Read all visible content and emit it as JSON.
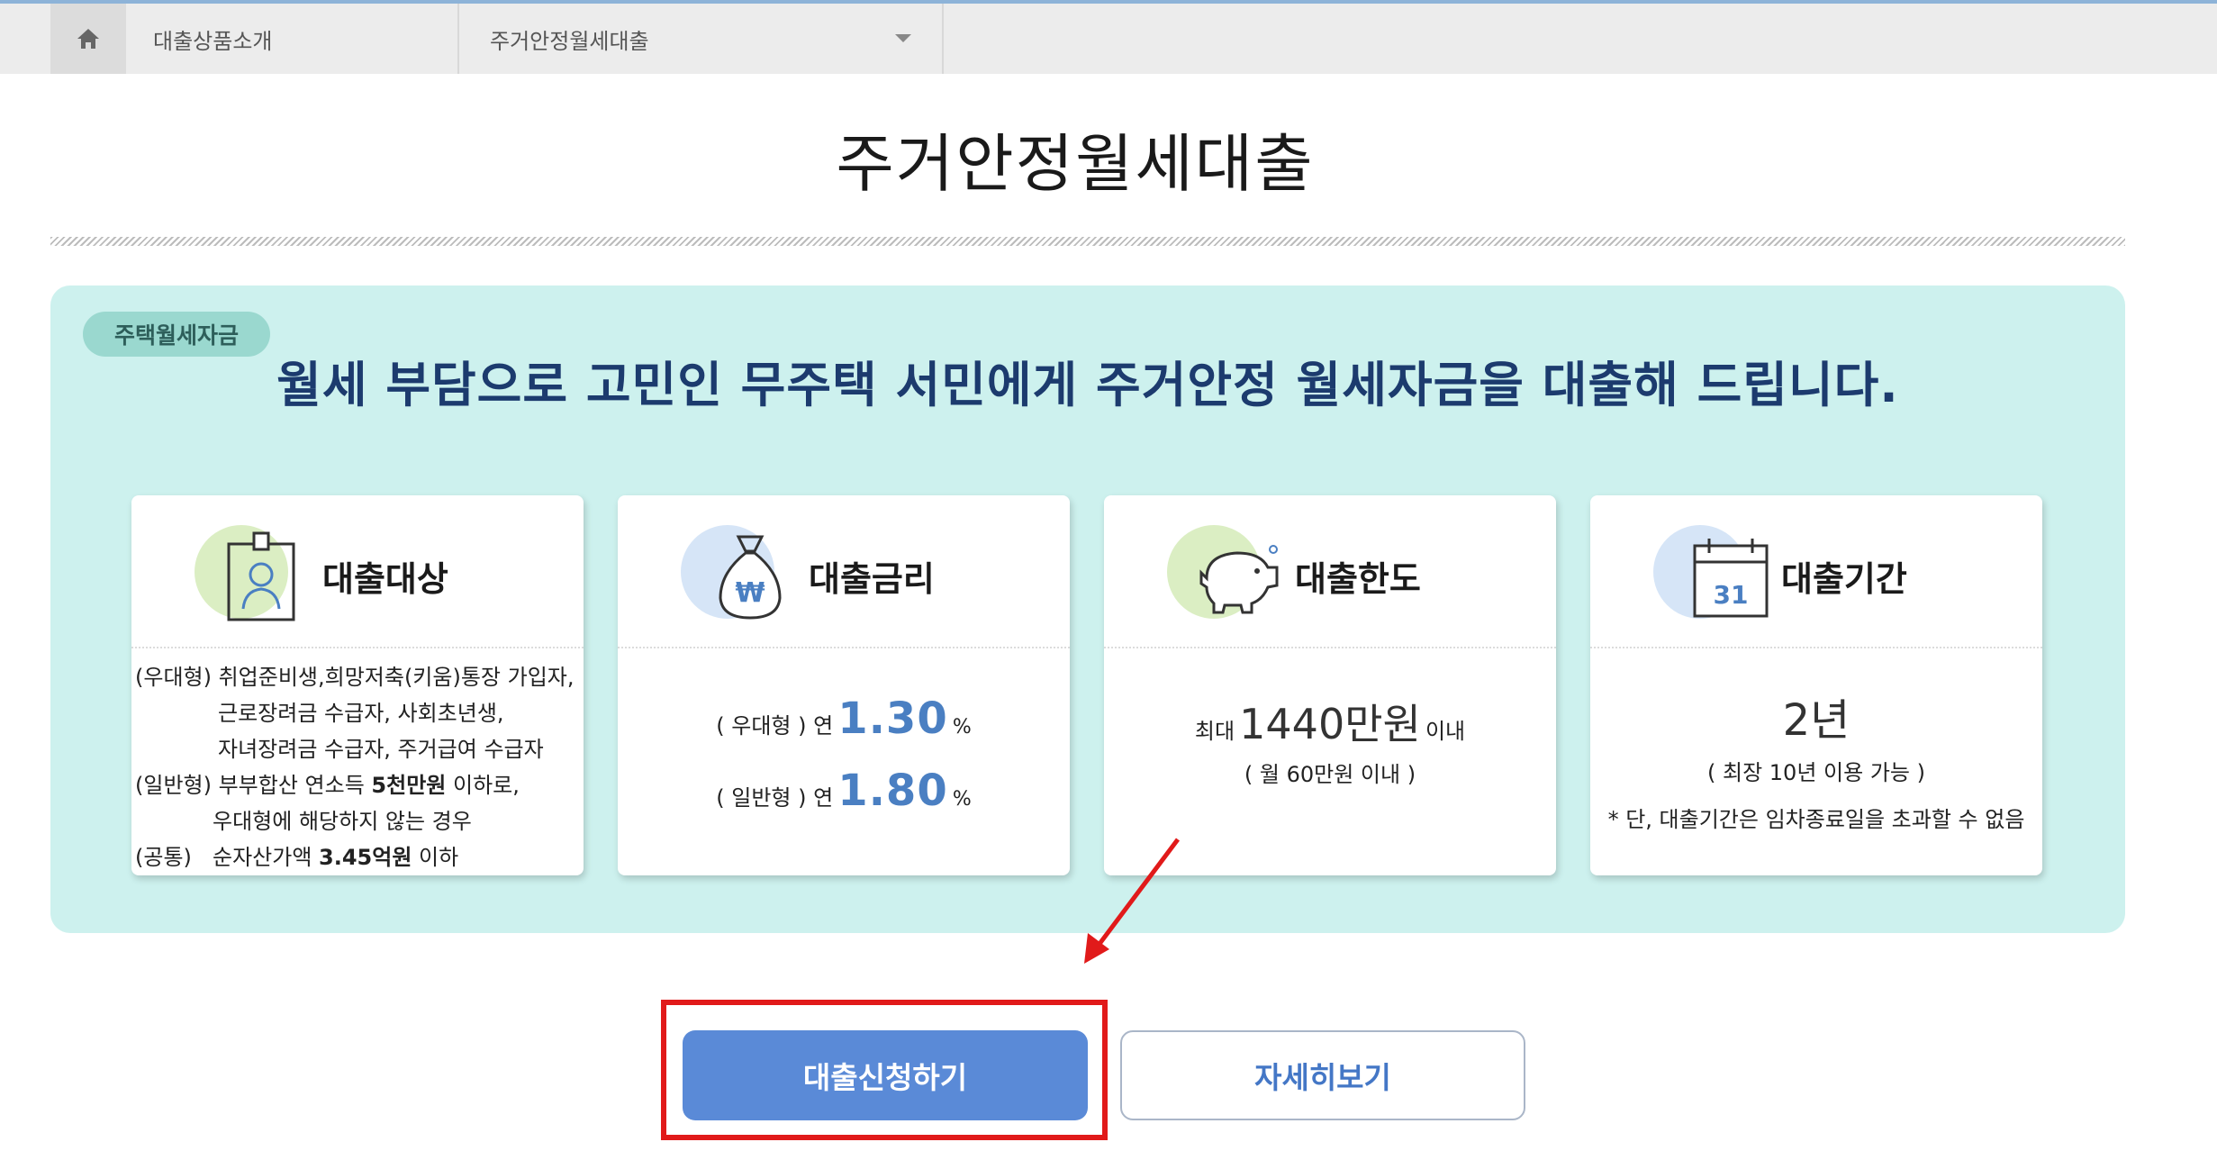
{
  "breadcrumb": {
    "home_icon": "home-icon",
    "item1": "대출상품소개",
    "item2": "주거안정월세대출"
  },
  "page_title": "주거안정월세대출",
  "panel": {
    "tag": "주택월세자금",
    "headline": "월세 부담으로 고민인 무주택 서민에게 주거안정 월세자금을 대출해 드립니다."
  },
  "cards": {
    "target": {
      "title": "대출대상",
      "icon": "id-badge-icon",
      "lines": [
        "(우대형) 취업준비생,희망저축(키움)통장 가입자,",
        "근로장려금 수급자, 사회초년생,",
        "자녀장려금 수급자, 주거급여 수급자",
        "(일반형) 부부합산 연소득 ",
        "5천만원",
        " 이하로,",
        "우대형에 해당하지 않는 경우",
        "(공통)",
        "순자산가액 ",
        "3.45억원",
        " 이하"
      ]
    },
    "rate": {
      "title": "대출금리",
      "icon": "money-bag-icon",
      "preferred": {
        "prefix": "( 우대형 ) 연",
        "value": "1.30",
        "unit": "%"
      },
      "general": {
        "prefix": "( 일반형 ) 연",
        "value": "1.80",
        "unit": "%"
      }
    },
    "limit": {
      "title": "대출한도",
      "icon": "piggy-bank-icon",
      "prefix": "최대",
      "amount": "1440만원",
      "suffix": "이내",
      "note": "( 월 60만원 이내 )"
    },
    "period": {
      "title": "대출기간",
      "icon": "calendar-icon",
      "calendar_day": "31",
      "value": "2년",
      "note": "( 최장 10년 이용 가능 )",
      "footnote": "* 단, 대출기간은 임차종료일을 초과할 수 없음"
    }
  },
  "buttons": {
    "apply": "대출신청하기",
    "more": "자세히보기"
  },
  "colors": {
    "panel_bg": "#cdf1ee",
    "accent_blue": "#5a8ad7",
    "headline": "#1c3b6e",
    "highlight_red": "#e11a1a"
  }
}
